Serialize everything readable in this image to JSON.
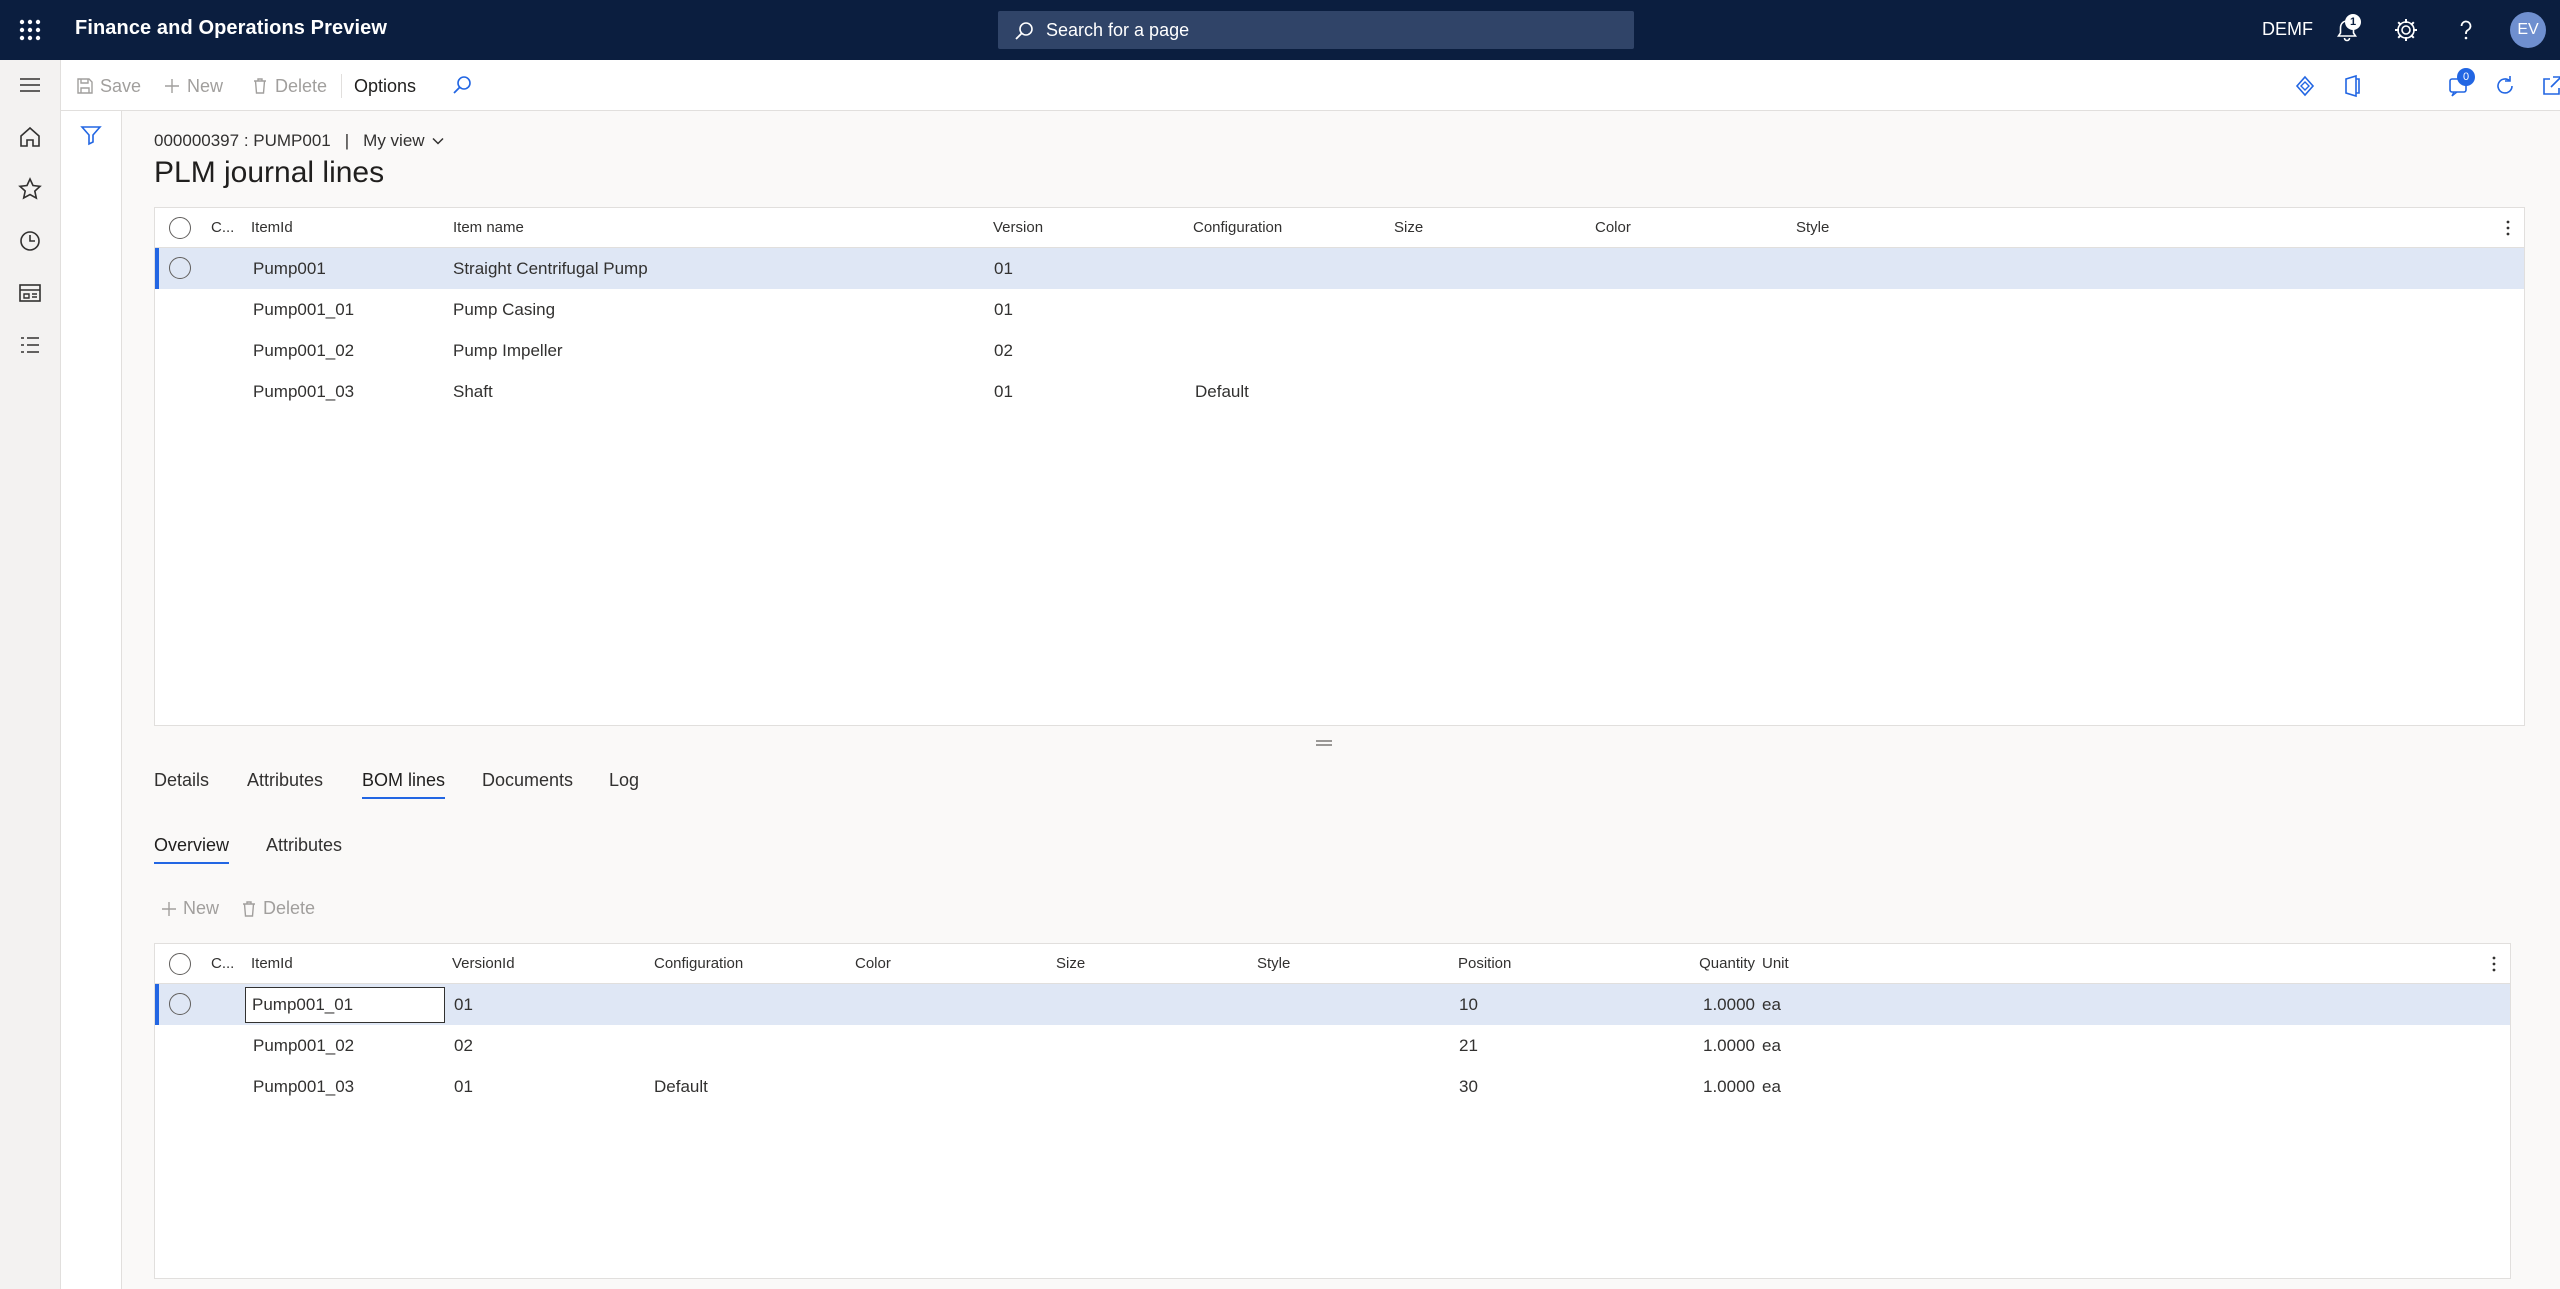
{
  "topbar": {
    "app_title": "Finance and Operations Preview",
    "search_placeholder": "Search for a page",
    "company": "DEMF",
    "notifications_count": "1",
    "avatar_initials": "EV"
  },
  "actionpane": {
    "save_label": "Save",
    "new_label": "New",
    "delete_label": "Delete",
    "options_label": "Options",
    "message_count": "0"
  },
  "header": {
    "caption": "000000397 : PUMP001",
    "separator": "|",
    "view_label": "My view",
    "title": "PLM journal lines"
  },
  "journal_grid": {
    "columns": {
      "check": "C...",
      "item_id": "ItemId",
      "item_name": "Item name",
      "version": "Version",
      "configuration": "Configuration",
      "size": "Size",
      "color": "Color",
      "style": "Style"
    },
    "rows": [
      {
        "item_id": "Pump001",
        "item_name": "Straight Centrifugal Pump",
        "version": "01",
        "configuration": "",
        "size": "",
        "color": "",
        "style": ""
      },
      {
        "item_id": "Pump001_01",
        "item_name": "Pump Casing",
        "version": "01",
        "configuration": "",
        "size": "",
        "color": "",
        "style": ""
      },
      {
        "item_id": "Pump001_02",
        "item_name": "Pump Impeller",
        "version": "02",
        "configuration": "",
        "size": "",
        "color": "",
        "style": ""
      },
      {
        "item_id": "Pump001_03",
        "item_name": "Shaft",
        "version": "01",
        "configuration": "Default",
        "size": "",
        "color": "",
        "style": ""
      }
    ]
  },
  "tabs": [
    {
      "label": "Details"
    },
    {
      "label": "Attributes"
    },
    {
      "label": "BOM lines"
    },
    {
      "label": "Documents"
    },
    {
      "label": "Log"
    }
  ],
  "subtabs": [
    {
      "label": "Overview"
    },
    {
      "label": "Attributes"
    }
  ],
  "bom_actions": {
    "new_label": "New",
    "delete_label": "Delete"
  },
  "bom_grid": {
    "columns": {
      "check": "C...",
      "item_id": "ItemId",
      "version_id": "VersionId",
      "configuration": "Configuration",
      "color": "Color",
      "size": "Size",
      "style": "Style",
      "position": "Position",
      "quantity": "Quantity",
      "unit": "Unit"
    },
    "rows": [
      {
        "item_id": "Pump001_01",
        "version_id": "01",
        "configuration": "",
        "color": "",
        "size": "",
        "style": "",
        "position": "10",
        "quantity": "1.0000",
        "unit": "ea"
      },
      {
        "item_id": "Pump001_02",
        "version_id": "02",
        "configuration": "",
        "color": "",
        "size": "",
        "style": "",
        "position": "21",
        "quantity": "1.0000",
        "unit": "ea"
      },
      {
        "item_id": "Pump001_03",
        "version_id": "01",
        "configuration": "Default",
        "color": "",
        "size": "",
        "style": "",
        "position": "30",
        "quantity": "1.0000",
        "unit": "ea"
      }
    ]
  },
  "colors": {
    "topbar_bg": "#0b1e3f",
    "accent": "#2266e3",
    "selected_row": "#dfe7f5"
  }
}
